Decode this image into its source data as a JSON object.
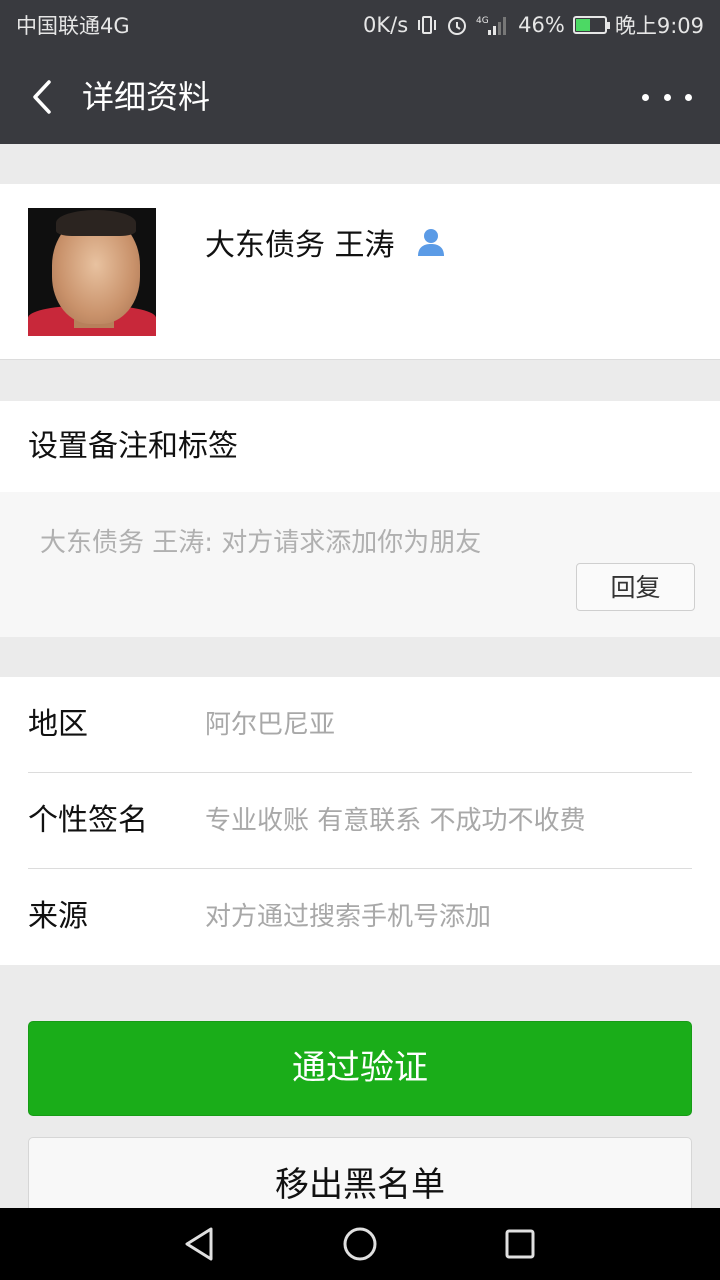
{
  "status_bar": {
    "carrier": "中国联通4G",
    "speed": "0K/s",
    "network": "4G",
    "battery": "46%",
    "battery_level": 0.46,
    "time": "晚上9:09"
  },
  "nav": {
    "title": "详细资料"
  },
  "profile": {
    "name": "大东债务  王涛"
  },
  "remark": {
    "label": "设置备注和标签"
  },
  "request": {
    "message": "大东债务  王涛: 对方请求添加你为朋友",
    "reply_label": "回复"
  },
  "info": {
    "rows": [
      {
        "key": "地区",
        "value": "阿尔巴尼亚"
      },
      {
        "key": "个性签名",
        "value": "专业收账 有意联系 不成功不收费"
      },
      {
        "key": "来源",
        "value": "对方通过搜索手机号添加"
      }
    ]
  },
  "actions": {
    "verify_label": "通过验证",
    "unblock_label": "移出黑名单"
  },
  "colors": {
    "primary_green": "#1aad19",
    "header_dark": "#393a3f",
    "contact_icon_blue": "#5b9be6"
  }
}
